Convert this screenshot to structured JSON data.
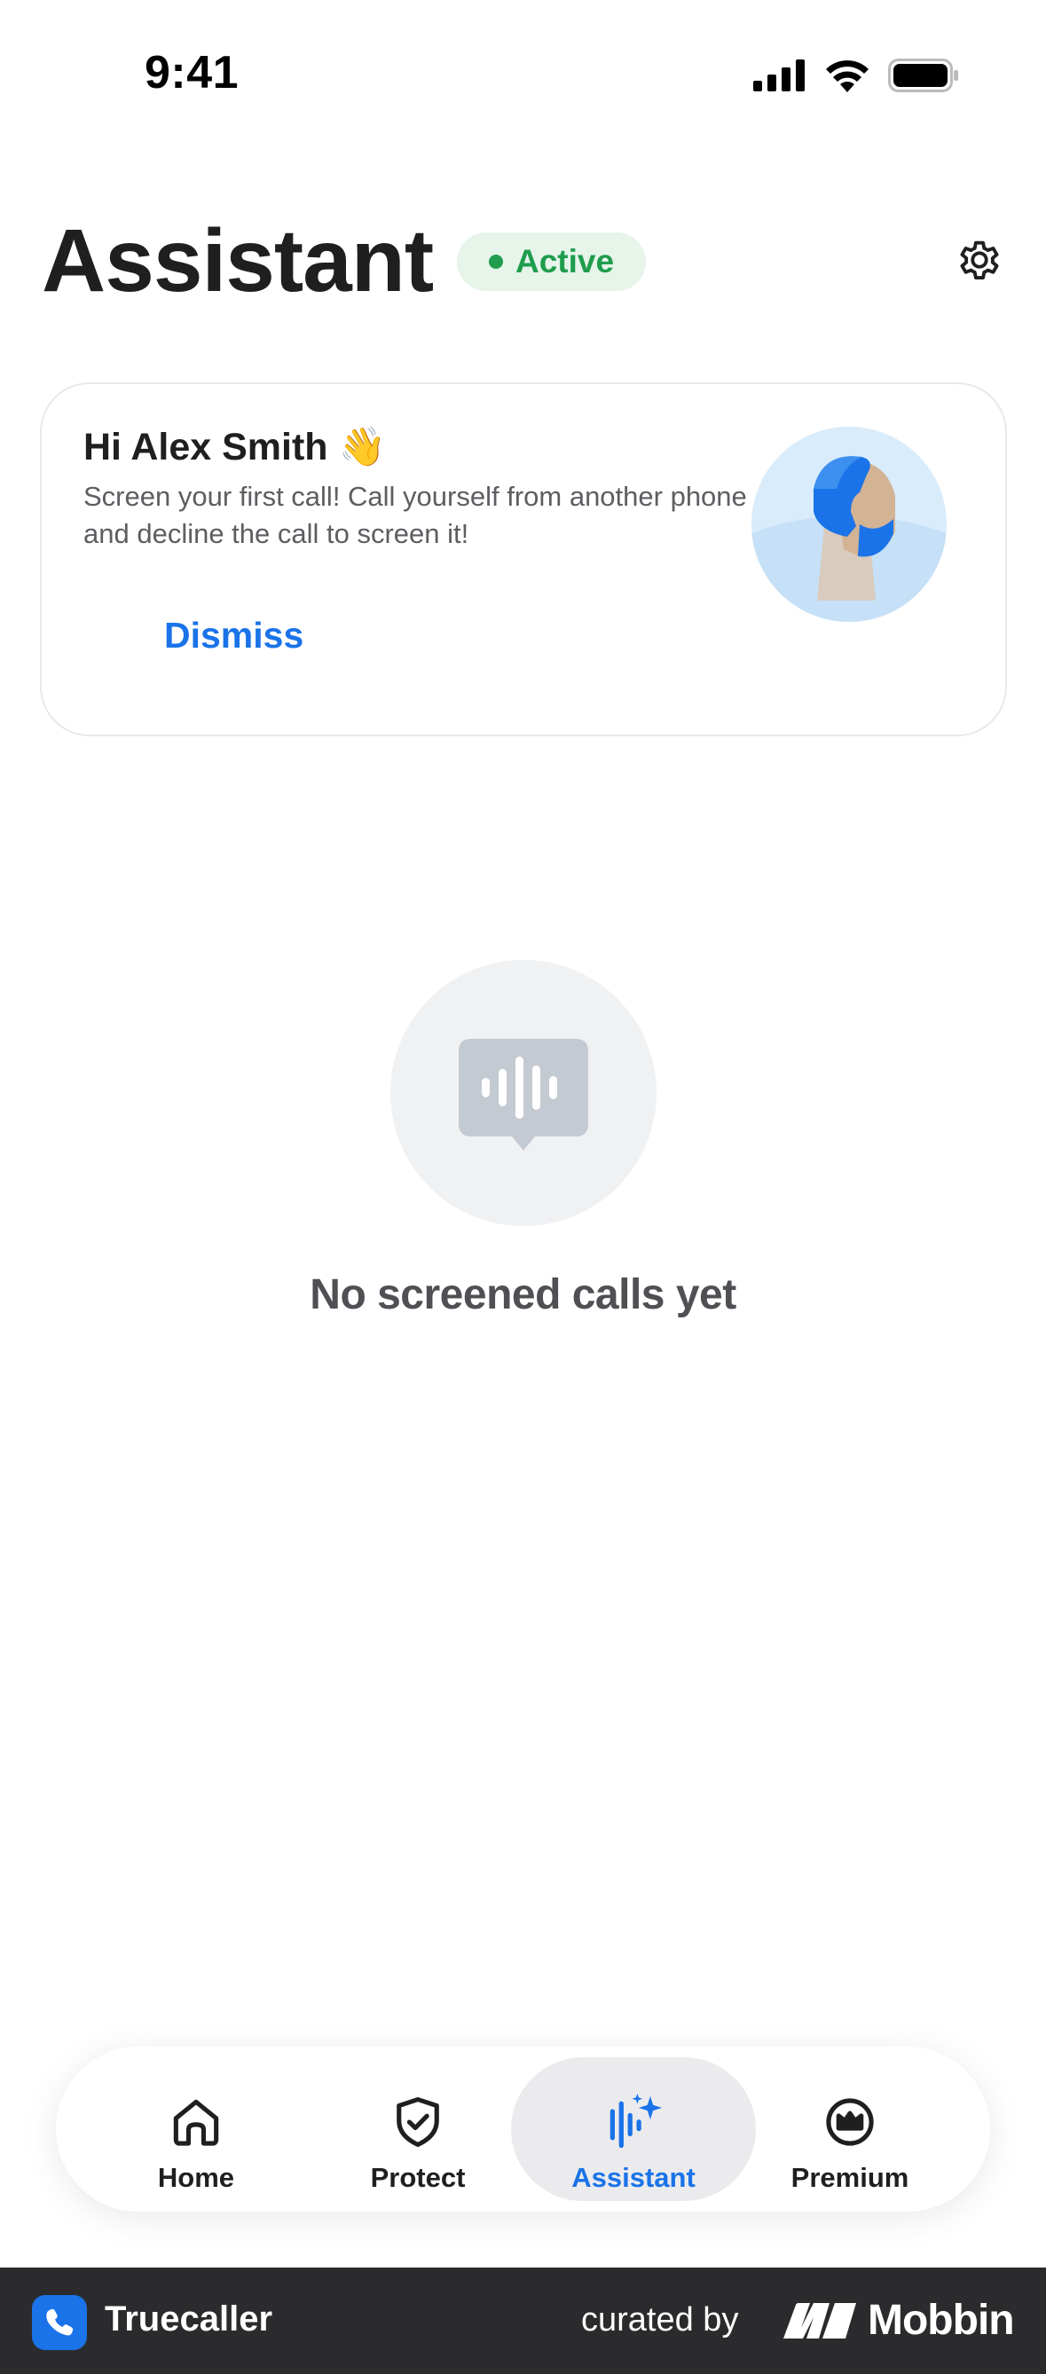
{
  "status_bar": {
    "time": "9:41"
  },
  "header": {
    "title": "Assistant",
    "status_badge": "Active",
    "status_color": "#1f9d4d",
    "settings_icon": "gear-icon"
  },
  "onboarding_card": {
    "greeting": "Hi Alex Smith 👋",
    "body": "Screen your first call! Call yourself from another phone and decline the call to screen it!",
    "dismiss_label": "Dismiss",
    "illustration_icon": "assistant-avatar-illustration"
  },
  "empty_state": {
    "icon": "voice-message-icon",
    "message": "No screened calls yet"
  },
  "tab_bar": {
    "tabs": [
      {
        "label": "Home",
        "icon": "home-icon",
        "selected": false
      },
      {
        "label": "Protect",
        "icon": "shield-check-icon",
        "selected": false
      },
      {
        "label": "Assistant",
        "icon": "assistant-sparkle-icon",
        "selected": true
      },
      {
        "label": "Premium",
        "icon": "crown-icon",
        "selected": false
      }
    ]
  },
  "footer": {
    "brand": "Truecaller",
    "curated_by": "curated by",
    "mobbin": "Mobbin"
  },
  "colors": {
    "accent": "#1a73e8",
    "active_green": "#1f9d4d",
    "footer_bg": "#2b2b2d"
  }
}
